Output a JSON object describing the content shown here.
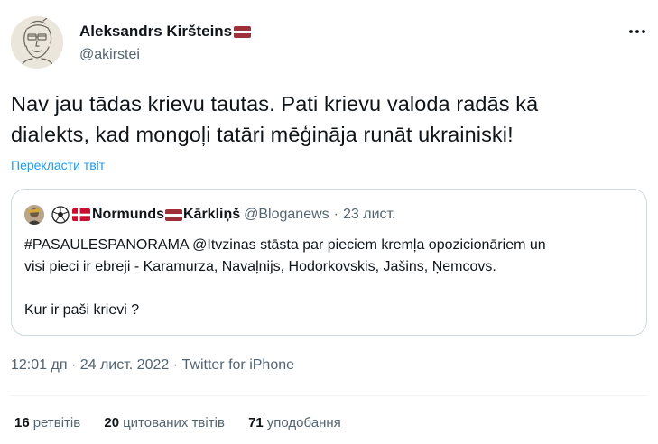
{
  "author": {
    "name": "Aleksandrs Kiršteins",
    "handle": "@akirstei",
    "flag_icon": "latvia-flag"
  },
  "tweet": {
    "text_lines": [
      "Nav jau tādas krievu tautas. Pati krievu valoda radās kā",
      "dialekts, kad mongoļi tatāri mēģināja runāt ukrainiski!"
    ],
    "translate_label": "Перекласти твіт"
  },
  "quoted": {
    "name_first": "Normunds",
    "name_last": "Kārkliņš",
    "handle": "@Bloganews",
    "separator": "·",
    "date": "23 лист.",
    "lines": [
      "#PASAULESPANORAMA @Itvzinas stāsta par pieciem kremļa opozicionāriem un",
      "visi pieci ir ebreji - Karamurza, Navaļnijs, Hodorkovskis, Jašins, Ņemcovs."
    ],
    "line_final": "Kur ir paši krievi ?"
  },
  "meta": {
    "time": "12:01 дп",
    "separator": "·",
    "date": "24 лист. 2022",
    "source": "Twitter for iPhone"
  },
  "stats": [
    {
      "count": "16",
      "label": "ретвітів"
    },
    {
      "count": "20",
      "label": "цитованих твітів"
    },
    {
      "count": "71",
      "label": "уподобання"
    }
  ],
  "colors": {
    "accent": "#1d9bf0",
    "secondary_text": "#536471",
    "latvia_red": "#9e3039"
  }
}
